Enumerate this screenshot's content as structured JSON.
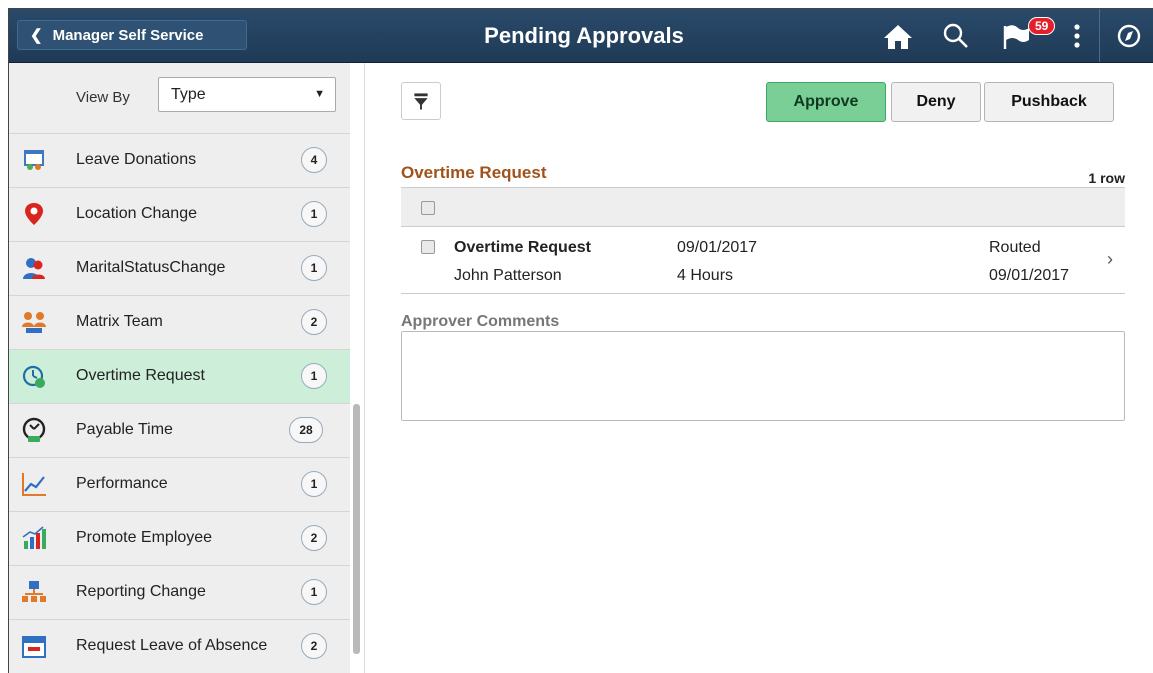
{
  "header": {
    "back_label": "Manager Self Service",
    "title": "Pending Approvals",
    "notification_count": "59",
    "icons": [
      "home-icon",
      "search-icon",
      "notification-flag-icon",
      "more-actions-icon",
      "navbar-compass-icon"
    ]
  },
  "sidebar": {
    "view_by_label": "View By",
    "view_by_value": "Type",
    "items": [
      {
        "label": "Leave Donations",
        "count": "4",
        "icon": "calendar-people-icon"
      },
      {
        "label": "Location Change",
        "count": "1",
        "icon": "map-pin-icon"
      },
      {
        "label": "MaritalStatusChange",
        "count": "1",
        "icon": "people-pair-icon"
      },
      {
        "label": "Matrix Team",
        "count": "2",
        "icon": "team-group-icon"
      },
      {
        "label": "Overtime Request",
        "count": "1",
        "icon": "overtime-clock-icon",
        "selected": true
      },
      {
        "label": "Payable Time",
        "count": "28",
        "icon": "payable-time-clock-icon"
      },
      {
        "label": "Performance",
        "count": "1",
        "icon": "line-chart-icon"
      },
      {
        "label": "Promote Employee",
        "count": "2",
        "icon": "bar-chart-up-icon"
      },
      {
        "label": "Reporting Change",
        "count": "1",
        "icon": "org-chart-icon"
      },
      {
        "label": "Request Leave of Absence",
        "count": "2",
        "icon": "calendar-icon"
      }
    ]
  },
  "toolbar": {
    "approve_label": "Approve",
    "deny_label": "Deny",
    "pushback_label": "Pushback"
  },
  "main": {
    "section_title": "Overtime Request",
    "row_count": "1 row",
    "rows": [
      {
        "type": "Overtime Request",
        "name": "John Patterson",
        "date": "09/01/2017",
        "hours": "4 Hours",
        "status": "Routed",
        "status_date": "09/01/2017"
      }
    ],
    "comments_label": "Approver Comments",
    "comments_value": ""
  },
  "colors": {
    "header_bg": "#1f3a56",
    "approve_bg": "#79cf95",
    "section_title": "#a0521a",
    "selected_row": "#cdeed9",
    "badge": "#e21f2b"
  }
}
